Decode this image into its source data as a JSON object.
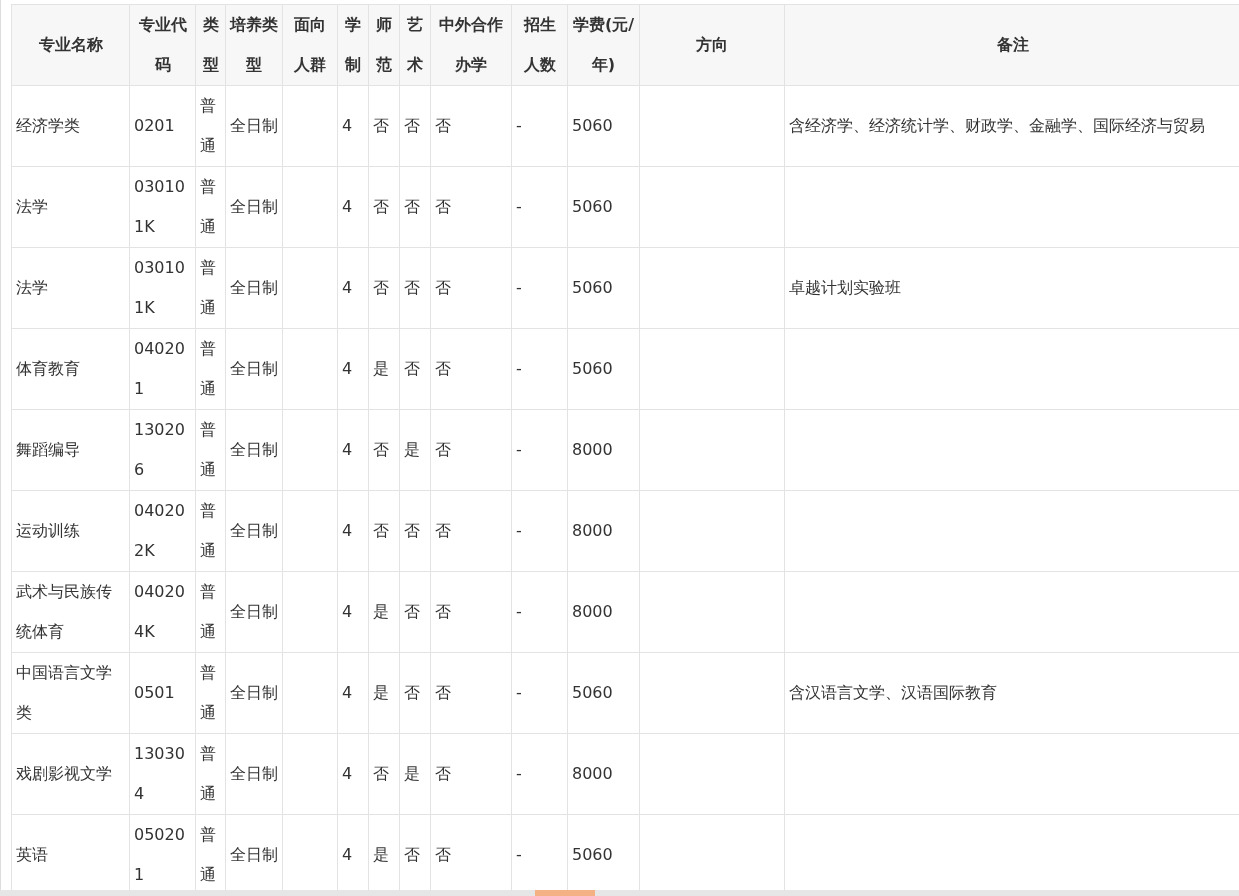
{
  "table": {
    "columns": [
      "专业名称",
      "专业代码",
      "类型",
      "培养类型",
      "面向人群",
      "学制",
      "师范",
      "艺术",
      "中外合作办学",
      "招生人数",
      "学费(元/年)",
      "方向",
      "备注"
    ],
    "rows": [
      {
        "name": "经济学类",
        "code": "0201",
        "type": "普通",
        "training": "全日制",
        "years": "4",
        "normal": "否",
        "art": "否",
        "joint": "否",
        "enrollment": "-",
        "fee": "5060",
        "remarks": "含经济学、经济统计学、财政学、金融学、国际经济与贸易"
      },
      {
        "name": "法学",
        "code": "030101K",
        "type": "普通",
        "training": "全日制",
        "years": "4",
        "normal": "否",
        "art": "否",
        "joint": "否",
        "enrollment": "-",
        "fee": "5060"
      },
      {
        "name": "法学",
        "code": "030101K",
        "type": "普通",
        "training": "全日制",
        "years": "4",
        "normal": "否",
        "art": "否",
        "joint": "否",
        "enrollment": "-",
        "fee": "5060",
        "remarks": "卓越计划实验班"
      },
      {
        "name": "体育教育",
        "code": "040201",
        "type": "普通",
        "training": "全日制",
        "years": "4",
        "normal": "是",
        "art": "否",
        "joint": "否",
        "enrollment": "-",
        "fee": "5060"
      },
      {
        "name": "舞蹈编导",
        "code": "130206",
        "type": "普通",
        "training": "全日制",
        "years": "4",
        "normal": "否",
        "art": "是",
        "joint": "否",
        "enrollment": "-",
        "fee": "8000"
      },
      {
        "name": "运动训练",
        "code": "040202K",
        "type": "普通",
        "training": "全日制",
        "years": "4",
        "normal": "否",
        "art": "否",
        "joint": "否",
        "enrollment": "-",
        "fee": "8000"
      },
      {
        "name": "武术与民族传统体育",
        "code": "040204K",
        "type": "普通",
        "training": "全日制",
        "years": "4",
        "normal": "是",
        "art": "否",
        "joint": "否",
        "enrollment": "-",
        "fee": "8000"
      },
      {
        "name": "中国语言文学类",
        "code": "0501",
        "type": "普通",
        "training": "全日制",
        "years": "4",
        "normal": "是",
        "art": "否",
        "joint": "否",
        "enrollment": "-",
        "fee": "5060",
        "remarks": "含汉语言文学、汉语国际教育"
      },
      {
        "name": "戏剧影视文学",
        "code": "130304",
        "type": "普通",
        "training": "全日制",
        "years": "4",
        "normal": "否",
        "art": "是",
        "joint": "否",
        "enrollment": "-",
        "fee": "8000"
      },
      {
        "name": "英语",
        "code": "050201",
        "type": "普通",
        "training": "全日制",
        "years": "4",
        "normal": "是",
        "art": "否",
        "joint": "否",
        "enrollment": "-",
        "fee": "5060"
      }
    ]
  }
}
